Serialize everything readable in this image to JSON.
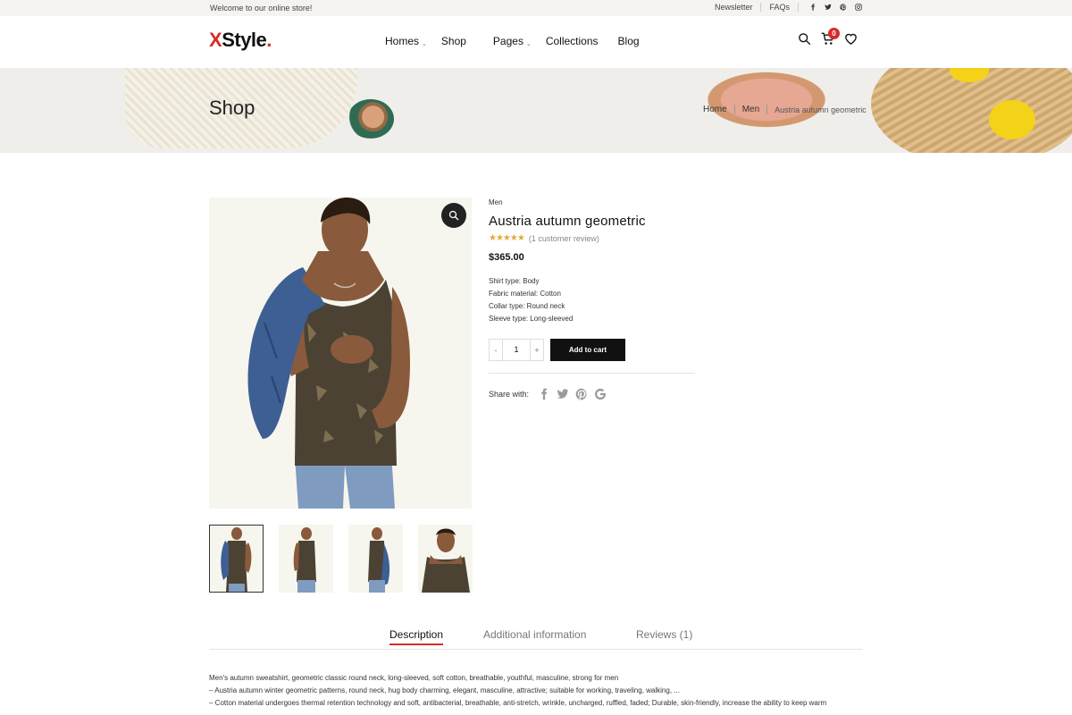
{
  "topbar": {
    "welcome": "Welcome to our online store!",
    "links": [
      "Newsletter",
      "FAQs"
    ],
    "social": [
      "facebook-icon",
      "twitter-icon",
      "pinterest-icon",
      "instagram-icon"
    ]
  },
  "header": {
    "logo_x": "X",
    "logo_rest": "Style",
    "logo_dot": ".",
    "nav": [
      {
        "label": "Homes",
        "dropdown": true
      },
      {
        "label": "Shop",
        "dropdown": false
      },
      {
        "label": "Pages",
        "dropdown": true
      },
      {
        "label": "Collections",
        "dropdown": false
      },
      {
        "label": "Blog",
        "dropdown": false
      }
    ],
    "cart_count": "0"
  },
  "banner": {
    "title": "Shop",
    "breadcrumb": [
      "Home",
      "Men",
      "Austria autumn geometric"
    ]
  },
  "product": {
    "category": "Men",
    "title": "Austria autumn geometric",
    "stars": "★★★★★",
    "rating": 5,
    "review_text": "(1 customer review)",
    "price": "$365.00",
    "specs": [
      "Shirt type: Body",
      "Fabric material: Cotton",
      "Collar type: Round neck",
      "Sleeve type: Long-sleeved"
    ],
    "qty_minus": "-",
    "qty_value": "1",
    "qty_plus": "+",
    "add_to_cart": "Add to cart",
    "share_label": "Share with:",
    "share_icons": [
      "facebook-icon",
      "twitter-icon",
      "pinterest-icon",
      "google-icon"
    ]
  },
  "tabs": {
    "description": "Description",
    "additional": "Additional information",
    "reviews": "Reviews (1)"
  },
  "description": [
    "Men's autumn sweatshirt, geometric classic round neck, long-sleeved, soft cotton, breathable, youthful, masculine, strong for men",
    "– Austria autumn winter geometric patterns, round neck, hug body charming, elegant, masculine, attractive; suitable for working, traveling, walking, ...",
    "– Cotton material undergoes thermal retention technology and soft, antibacterial, breathable, anti-stretch, wrinkle, uncharged, ruffled, faded; Durable, skin-friendly, increase the ability to keep warm"
  ],
  "colors": {
    "accent": "#d72b2b",
    "star": "#e3a93a",
    "button": "#111111"
  }
}
